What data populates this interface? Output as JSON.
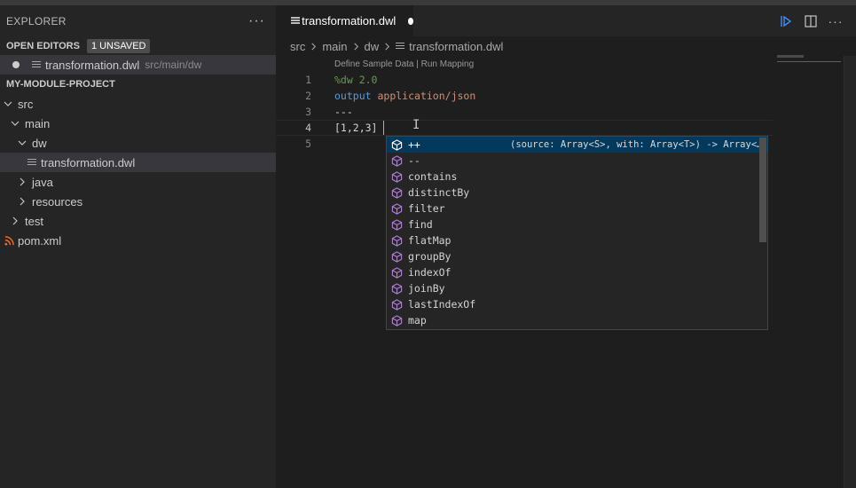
{
  "sidebar": {
    "title": "EXPLORER",
    "more_label": "···",
    "open_editors": {
      "title": "OPEN EDITORS",
      "badge": "1 UNSAVED",
      "items": [
        {
          "name": "transformation.dwl",
          "path": "src/main/dw"
        }
      ]
    },
    "project": {
      "title": "MY-MODULE-PROJECT",
      "tree": [
        {
          "label": "src"
        },
        {
          "label": "main"
        },
        {
          "label": "dw"
        },
        {
          "label": "transformation.dwl"
        },
        {
          "label": "java"
        },
        {
          "label": "resources"
        },
        {
          "label": "test"
        },
        {
          "label": "pom.xml"
        }
      ]
    }
  },
  "editor": {
    "tab": {
      "label": "transformation.dwl"
    },
    "breadcrumb": [
      "src",
      "main",
      "dw",
      "transformation.dwl"
    ],
    "codelens": "Define Sample Data | Run Mapping",
    "line_numbers": [
      "1",
      "2",
      "3",
      "4",
      "5"
    ],
    "code": {
      "l1": "%dw 2.0",
      "l2_kw": "output",
      "l2_str": "application/json",
      "l3": "---",
      "l4": "[1,2,3]"
    }
  },
  "suggest": {
    "detail": "(source: Array<S>, with: Array<T>) -> Array<…",
    "items": [
      "++",
      "--",
      "contains",
      "distinctBy",
      "filter",
      "find",
      "flatMap",
      "groupBy",
      "indexOf",
      "joinBy",
      "lastIndexOf",
      "map"
    ]
  },
  "colors": {
    "suggest_icon": "#b180d7",
    "selection": "#04395e",
    "comment": "#6a9955",
    "keyword": "#569cd6",
    "string": "#ce9178"
  }
}
